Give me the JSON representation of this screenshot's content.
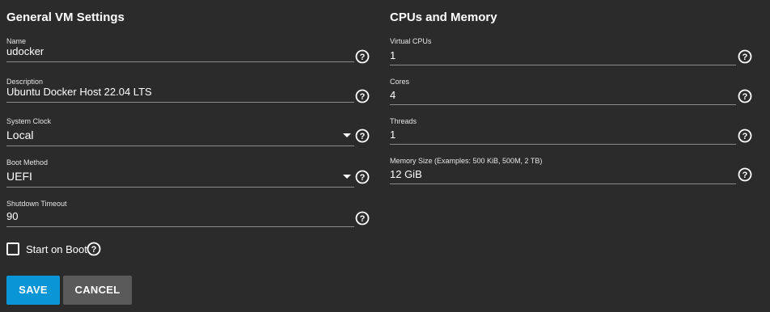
{
  "general": {
    "title": "General VM Settings",
    "fields": [
      {
        "label": "Name",
        "value": "udocker"
      },
      {
        "label": "Description",
        "value": "Ubuntu Docker Host 22.04 LTS"
      },
      {
        "label": "System Clock",
        "value": "Local"
      },
      {
        "label": "Boot Method",
        "value": "UEFI"
      },
      {
        "label": "Shutdown Timeout",
        "value": "90"
      }
    ],
    "start_on_boot": {
      "label": "Start on Boot",
      "checked": false
    }
  },
  "cpus": {
    "title": "CPUs and Memory",
    "fields": [
      {
        "label": "Virtual CPUs",
        "value": "1"
      },
      {
        "label": "Cores",
        "value": "4"
      },
      {
        "label": "Threads",
        "value": "1"
      },
      {
        "label": "Memory Size (Examples: 500 KiB, 500M, 2 TB)",
        "value": "12 GiB"
      }
    ]
  },
  "buttons": {
    "save_label": "SAVE",
    "cancel_label": "CANCEL"
  },
  "colors": {
    "background": "#2b2b2b",
    "primary": "#0a95d6",
    "secondary_button": "#5a5a5a"
  },
  "icons": {
    "help": "help-circle-icon",
    "dropdown": "caret-down-icon"
  }
}
